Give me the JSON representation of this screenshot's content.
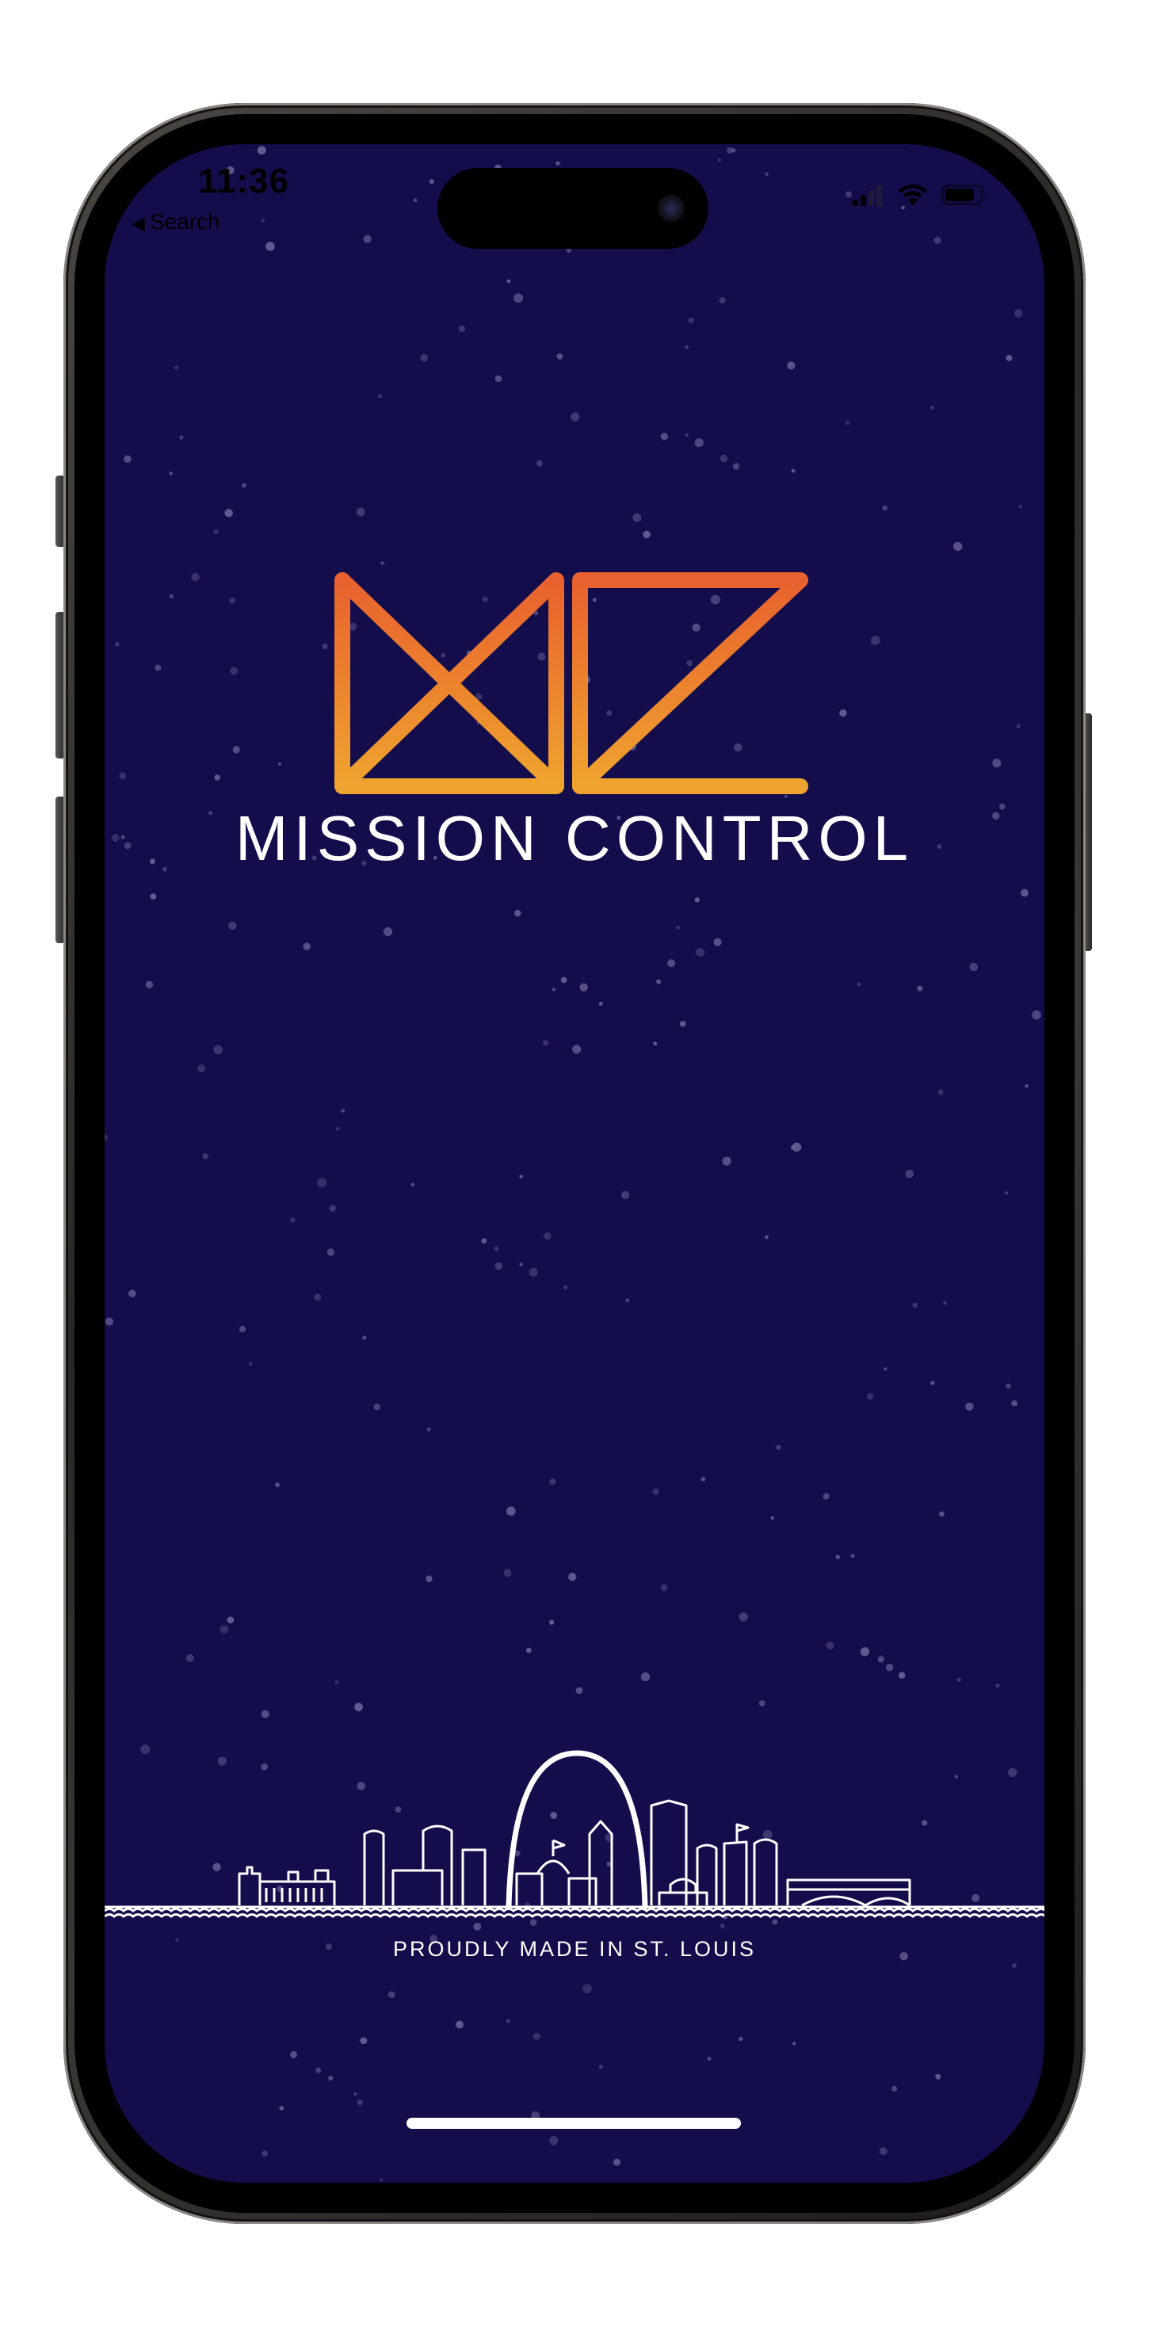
{
  "status_bar": {
    "time": "11:36",
    "back_label": "Search",
    "back_icon": "triangle-left-icon",
    "signal_icon": "cellular-signal-icon",
    "wifi_icon": "wifi-icon",
    "battery_icon": "battery-icon"
  },
  "app": {
    "logo_icon": "mc-logo-icon",
    "name": "MISSION CONTROL",
    "tagline": "PROUDLY MADE IN ST. LOUIS",
    "skyline_icon": "st-louis-skyline-icon"
  },
  "colors": {
    "background": "#130d4c",
    "logo_top": "#e8612e",
    "logo_bottom": "#f0a42f",
    "text": "#ffffff",
    "star": "#6f6a9e"
  }
}
